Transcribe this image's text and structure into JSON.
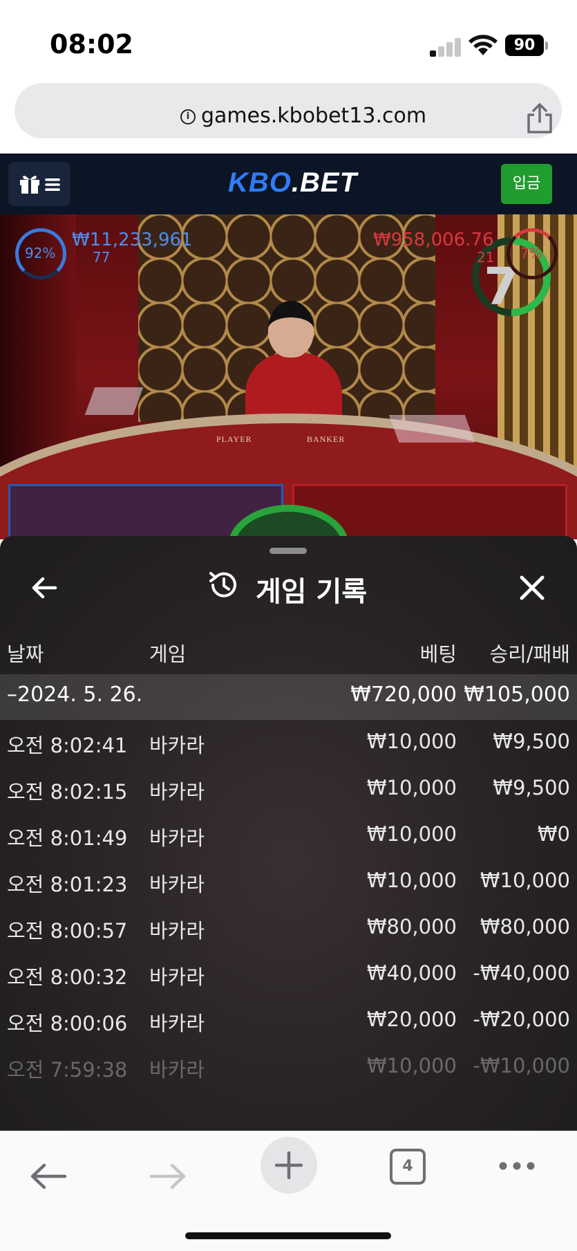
{
  "status": {
    "time": "08:02",
    "battery": "90"
  },
  "browser": {
    "url": "games.kbobet13.com",
    "tab_count": "4"
  },
  "site": {
    "logo_left": "KBO",
    "logo_right": ".BET",
    "deposit_label": "입금"
  },
  "game": {
    "timer": "7",
    "player": {
      "percent": "92%",
      "amount": "₩11,233,961",
      "count": "77"
    },
    "banker": {
      "percent": "7%",
      "amount": "₩958,006.76",
      "count": "21"
    },
    "table_player_label": "PLAYER",
    "table_banker_label": "BANKER"
  },
  "history": {
    "title": "게임 기록",
    "columns": {
      "date": "날짜",
      "game": "게임",
      "bet": "베팅",
      "win_loss": "승리/패배"
    },
    "summary": {
      "date": "–2024. 5. 26.",
      "bet": "₩720,000",
      "win_loss": "₩105,000"
    },
    "rows": [
      {
        "time": "오전 8:02:41",
        "game": "바카라",
        "bet": "₩10,000",
        "win_loss": "₩9,500"
      },
      {
        "time": "오전 8:02:15",
        "game": "바카라",
        "bet": "₩10,000",
        "win_loss": "₩9,500"
      },
      {
        "time": "오전 8:01:49",
        "game": "바카라",
        "bet": "₩10,000",
        "win_loss": "₩0"
      },
      {
        "time": "오전 8:01:23",
        "game": "바카라",
        "bet": "₩10,000",
        "win_loss": "₩10,000"
      },
      {
        "time": "오전 8:00:57",
        "game": "바카라",
        "bet": "₩80,000",
        "win_loss": "₩80,000"
      },
      {
        "time": "오전 8:00:32",
        "game": "바카라",
        "bet": "₩40,000",
        "win_loss": "-₩40,000"
      },
      {
        "time": "오전 8:00:06",
        "game": "바카라",
        "bet": "₩20,000",
        "win_loss": "-₩20,000"
      },
      {
        "time": "오전 7:59:38",
        "game": "바카라",
        "bet": "₩10,000",
        "win_loss": "-₩10,000"
      }
    ]
  },
  "colors": {
    "header_bg": "#0b1526",
    "logo_blue": "#2f7cf6",
    "deposit_green": "#1f9d2f",
    "player_blue": "#4e8ef0",
    "banker_red": "#d9393f"
  }
}
